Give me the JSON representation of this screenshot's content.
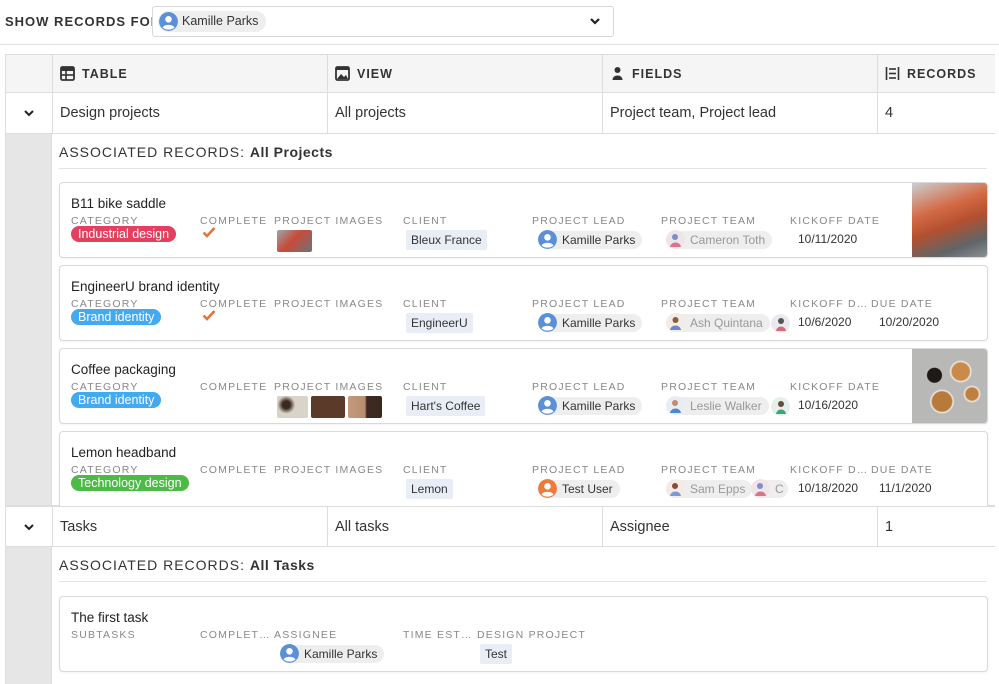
{
  "header": {
    "show_label": "SHOW RECORDS FOR:",
    "selected_user": "Kamille Parks"
  },
  "columns": [
    {
      "label": "TABLE",
      "icon": "table-icon"
    },
    {
      "label": "VIEW",
      "icon": "gallery-icon"
    },
    {
      "label": "FIELDS",
      "icon": "person-icon"
    },
    {
      "label": "RECORDS",
      "icon": "records-icon"
    }
  ],
  "rows": [
    {
      "table": "Design projects",
      "view": "All projects",
      "fields": "Project team, Project lead",
      "records": "4",
      "assoc_prefix": "ASSOCIATED RECORDS: ",
      "assoc_view": "All Projects"
    },
    {
      "table": "Tasks",
      "view": "All tasks",
      "fields": "Assignee",
      "records": "1",
      "assoc_prefix": "ASSOCIATED RECORDS: ",
      "assoc_view": "All Tasks"
    }
  ],
  "field_labels": {
    "category": "CATEGORY",
    "complete": "COMPLETE",
    "project_images": "PROJECT IMAGES",
    "client": "CLIENT",
    "project_lead": "PROJECT LEAD",
    "project_team": "PROJECT TEAM",
    "kickoff_date": "KICKOFF DATE",
    "kickoff_date_short": "KICKOFF D…",
    "due_date": "DUE DATE",
    "subtasks": "SUBTASKS",
    "complete_short": "COMPLET…",
    "assignee": "ASSIGNEE",
    "time_est": "TIME EST…",
    "design_project": "DESIGN PROJECT"
  },
  "projects": [
    {
      "name": "B11 bike saddle",
      "category": "Industrial design",
      "category_color": "#e2405e",
      "complete": true,
      "client": "Bleux France",
      "lead": "Kamille Parks",
      "team": [
        "Cameron Toth"
      ],
      "kickoff": "10/11/2020",
      "due": ""
    },
    {
      "name": "EngineerU brand identity",
      "category": "Brand identity",
      "category_color": "#42aaf0",
      "complete": true,
      "client": "EngineerU",
      "lead": "Kamille Parks",
      "team": [
        "Ash Quintana",
        ""
      ],
      "kickoff": "10/6/2020",
      "due": "10/20/2020"
    },
    {
      "name": "Coffee packaging",
      "category": "Brand identity",
      "category_color": "#42aaf0",
      "complete": false,
      "client": "Hart's Coffee",
      "lead": "Kamille Parks",
      "team": [
        "Leslie Walker",
        ""
      ],
      "kickoff": "10/16/2020",
      "due": ""
    },
    {
      "name": "Lemon headband",
      "category": "Technology design",
      "category_color": "#4cbb45",
      "complete": false,
      "client": "Lemon",
      "lead": "Test User",
      "team": [
        "Sam Epps",
        "C"
      ],
      "kickoff": "10/18/2020",
      "due": "11/1/2020"
    }
  ],
  "tasks": [
    {
      "name": "The first task",
      "assignee": "Kamille Parks",
      "design_project": "Test"
    }
  ],
  "colors": {
    "check": "#e5743a",
    "avatar_blue": "#5b8fd8",
    "avatar_orange": "#ee7b3c"
  }
}
